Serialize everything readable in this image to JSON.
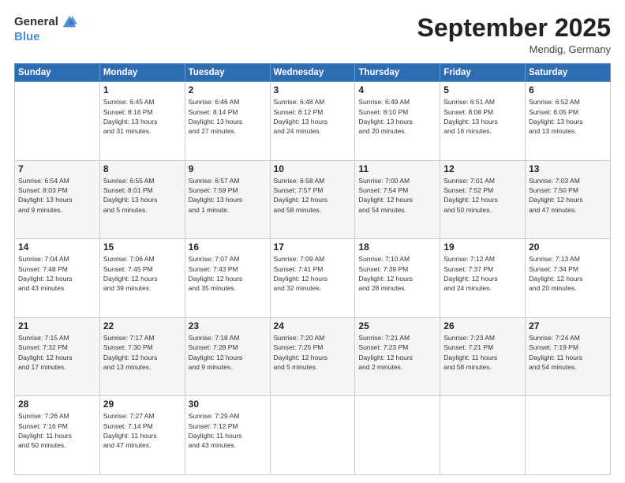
{
  "header": {
    "logo_general": "General",
    "logo_blue": "Blue",
    "month": "September 2025",
    "location": "Mendig, Germany"
  },
  "weekdays": [
    "Sunday",
    "Monday",
    "Tuesday",
    "Wednesday",
    "Thursday",
    "Friday",
    "Saturday"
  ],
  "weeks": [
    [
      {
        "day": "",
        "detail": ""
      },
      {
        "day": "1",
        "detail": "Sunrise: 6:45 AM\nSunset: 8:16 PM\nDaylight: 13 hours\nand 31 minutes."
      },
      {
        "day": "2",
        "detail": "Sunrise: 6:46 AM\nSunset: 8:14 PM\nDaylight: 13 hours\nand 27 minutes."
      },
      {
        "day": "3",
        "detail": "Sunrise: 6:48 AM\nSunset: 8:12 PM\nDaylight: 13 hours\nand 24 minutes."
      },
      {
        "day": "4",
        "detail": "Sunrise: 6:49 AM\nSunset: 8:10 PM\nDaylight: 13 hours\nand 20 minutes."
      },
      {
        "day": "5",
        "detail": "Sunrise: 6:51 AM\nSunset: 8:08 PM\nDaylight: 13 hours\nand 16 minutes."
      },
      {
        "day": "6",
        "detail": "Sunrise: 6:52 AM\nSunset: 8:05 PM\nDaylight: 13 hours\nand 13 minutes."
      }
    ],
    [
      {
        "day": "7",
        "detail": "Sunrise: 6:54 AM\nSunset: 8:03 PM\nDaylight: 13 hours\nand 9 minutes."
      },
      {
        "day": "8",
        "detail": "Sunrise: 6:55 AM\nSunset: 8:01 PM\nDaylight: 13 hours\nand 5 minutes."
      },
      {
        "day": "9",
        "detail": "Sunrise: 6:57 AM\nSunset: 7:59 PM\nDaylight: 13 hours\nand 1 minute."
      },
      {
        "day": "10",
        "detail": "Sunrise: 6:58 AM\nSunset: 7:57 PM\nDaylight: 12 hours\nand 58 minutes."
      },
      {
        "day": "11",
        "detail": "Sunrise: 7:00 AM\nSunset: 7:54 PM\nDaylight: 12 hours\nand 54 minutes."
      },
      {
        "day": "12",
        "detail": "Sunrise: 7:01 AM\nSunset: 7:52 PM\nDaylight: 12 hours\nand 50 minutes."
      },
      {
        "day": "13",
        "detail": "Sunrise: 7:03 AM\nSunset: 7:50 PM\nDaylight: 12 hours\nand 47 minutes."
      }
    ],
    [
      {
        "day": "14",
        "detail": "Sunrise: 7:04 AM\nSunset: 7:48 PM\nDaylight: 12 hours\nand 43 minutes."
      },
      {
        "day": "15",
        "detail": "Sunrise: 7:06 AM\nSunset: 7:45 PM\nDaylight: 12 hours\nand 39 minutes."
      },
      {
        "day": "16",
        "detail": "Sunrise: 7:07 AM\nSunset: 7:43 PM\nDaylight: 12 hours\nand 35 minutes."
      },
      {
        "day": "17",
        "detail": "Sunrise: 7:09 AM\nSunset: 7:41 PM\nDaylight: 12 hours\nand 32 minutes."
      },
      {
        "day": "18",
        "detail": "Sunrise: 7:10 AM\nSunset: 7:39 PM\nDaylight: 12 hours\nand 28 minutes."
      },
      {
        "day": "19",
        "detail": "Sunrise: 7:12 AM\nSunset: 7:37 PM\nDaylight: 12 hours\nand 24 minutes."
      },
      {
        "day": "20",
        "detail": "Sunrise: 7:13 AM\nSunset: 7:34 PM\nDaylight: 12 hours\nand 20 minutes."
      }
    ],
    [
      {
        "day": "21",
        "detail": "Sunrise: 7:15 AM\nSunset: 7:32 PM\nDaylight: 12 hours\nand 17 minutes."
      },
      {
        "day": "22",
        "detail": "Sunrise: 7:17 AM\nSunset: 7:30 PM\nDaylight: 12 hours\nand 13 minutes."
      },
      {
        "day": "23",
        "detail": "Sunrise: 7:18 AM\nSunset: 7:28 PM\nDaylight: 12 hours\nand 9 minutes."
      },
      {
        "day": "24",
        "detail": "Sunrise: 7:20 AM\nSunset: 7:25 PM\nDaylight: 12 hours\nand 5 minutes."
      },
      {
        "day": "25",
        "detail": "Sunrise: 7:21 AM\nSunset: 7:23 PM\nDaylight: 12 hours\nand 2 minutes."
      },
      {
        "day": "26",
        "detail": "Sunrise: 7:23 AM\nSunset: 7:21 PM\nDaylight: 11 hours\nand 58 minutes."
      },
      {
        "day": "27",
        "detail": "Sunrise: 7:24 AM\nSunset: 7:19 PM\nDaylight: 11 hours\nand 54 minutes."
      }
    ],
    [
      {
        "day": "28",
        "detail": "Sunrise: 7:26 AM\nSunset: 7:16 PM\nDaylight: 11 hours\nand 50 minutes."
      },
      {
        "day": "29",
        "detail": "Sunrise: 7:27 AM\nSunset: 7:14 PM\nDaylight: 11 hours\nand 47 minutes."
      },
      {
        "day": "30",
        "detail": "Sunrise: 7:29 AM\nSunset: 7:12 PM\nDaylight: 11 hours\nand 43 minutes."
      },
      {
        "day": "",
        "detail": ""
      },
      {
        "day": "",
        "detail": ""
      },
      {
        "day": "",
        "detail": ""
      },
      {
        "day": "",
        "detail": ""
      }
    ]
  ]
}
